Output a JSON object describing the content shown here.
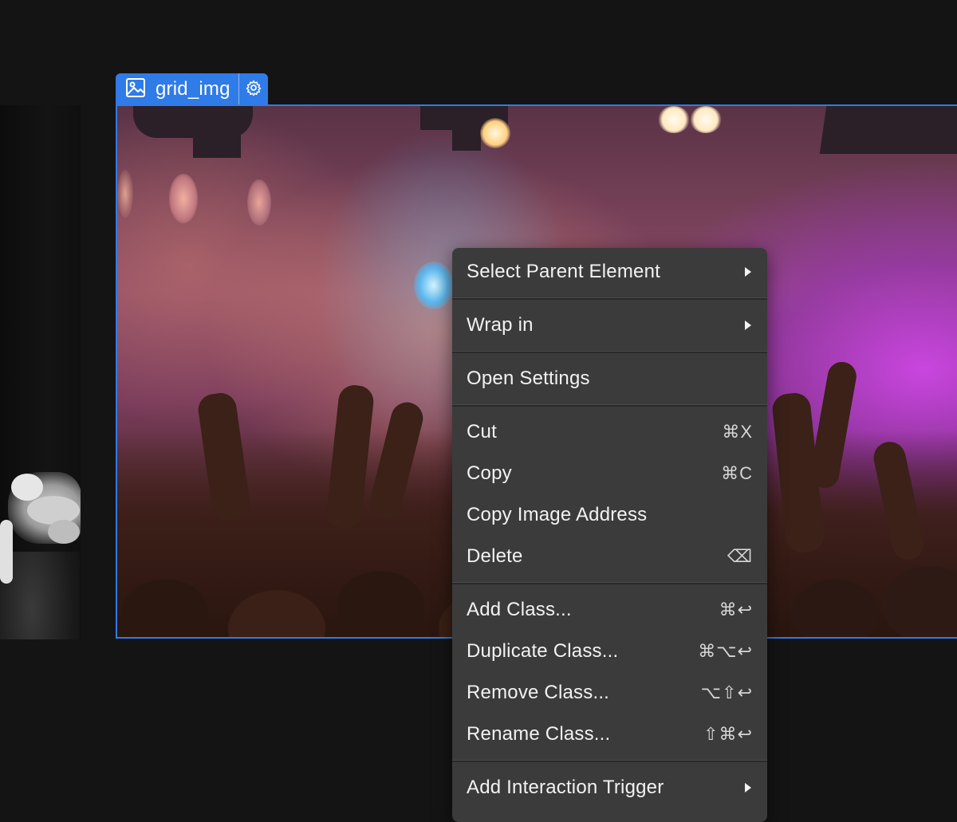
{
  "element_tag": {
    "label": "grid_img",
    "type_icon": "image-icon",
    "settings_icon": "gear-icon"
  },
  "colors": {
    "selection_accent": "#2f7be8",
    "menu_background": "#3b3b3b",
    "canvas_background": "#141414"
  },
  "context_menu": {
    "groups": [
      [
        {
          "label": "Select Parent Element",
          "submenu": true
        }
      ],
      [
        {
          "label": "Wrap in",
          "submenu": true
        }
      ],
      [
        {
          "label": "Open Settings"
        }
      ],
      [
        {
          "label": "Cut",
          "shortcut": "⌘X"
        },
        {
          "label": "Copy",
          "shortcut": "⌘C"
        },
        {
          "label": "Copy Image Address"
        },
        {
          "label": "Delete",
          "shortcut": "⌫"
        }
      ],
      [
        {
          "label": "Add Class...",
          "shortcut": "⌘↩"
        },
        {
          "label": "Duplicate Class...",
          "shortcut": "⌘⌥↩"
        },
        {
          "label": "Remove Class...",
          "shortcut": "⌥⇧↩"
        },
        {
          "label": "Rename Class...",
          "shortcut": "⇧⌘↩"
        }
      ],
      [
        {
          "label": "Add Interaction Trigger",
          "submenu": true
        }
      ]
    ]
  }
}
